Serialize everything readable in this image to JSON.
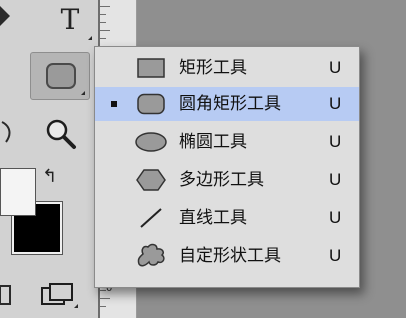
{
  "toolbox": {
    "type_tool": {
      "glyph": "T",
      "icon": "type-tool-icon"
    },
    "shape_tool": {
      "icon": "rounded-rectangle-tool-icon"
    },
    "zoom_tool": {
      "icon": "zoom-icon"
    },
    "swap_colors": {
      "glyph": "↰",
      "icon": "swap-colors-icon"
    },
    "foreground_color": "#f4f4f4",
    "background_color": "#000000",
    "screen_mode": {
      "icon": "screen-mode-icon"
    },
    "ruler_label": "0"
  },
  "menu": {
    "items": [
      {
        "label": "矩形工具",
        "shortcut": "U",
        "icon": "rectangle-icon",
        "selected": false
      },
      {
        "label": "圆角矩形工具",
        "shortcut": "U",
        "icon": "rounded-rectangle-icon",
        "selected": true
      },
      {
        "label": "椭圆工具",
        "shortcut": "U",
        "icon": "ellipse-icon",
        "selected": false
      },
      {
        "label": "多边形工具",
        "shortcut": "U",
        "icon": "polygon-icon",
        "selected": false
      },
      {
        "label": "直线工具",
        "shortcut": "U",
        "icon": "line-icon",
        "selected": false
      },
      {
        "label": "自定形状工具",
        "shortcut": "U",
        "icon": "custom-shape-icon",
        "selected": false
      }
    ]
  },
  "colors": {
    "selection": "#b7cbf3",
    "menu_bg": "#dedede"
  }
}
